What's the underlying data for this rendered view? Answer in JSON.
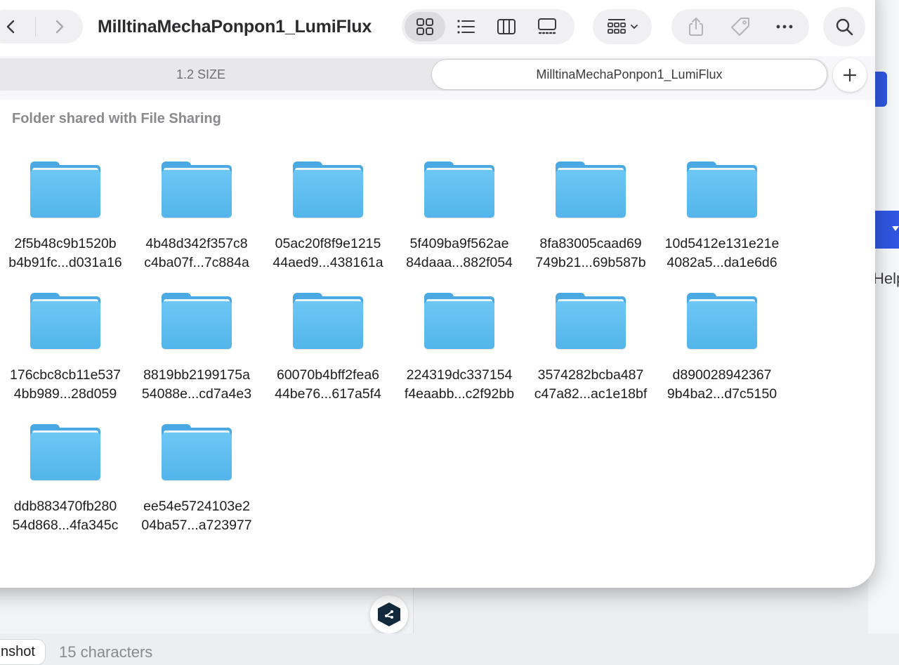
{
  "window": {
    "title": "MilltinaMechaPonpon1_LumiFlux"
  },
  "toolbar": {
    "nav": {
      "back_icon": "chevron-left-icon",
      "forward_icon": "chevron-right-icon"
    },
    "views": [
      {
        "icon": "icon-view-icon",
        "active": true
      },
      {
        "icon": "list-view-icon",
        "active": false
      },
      {
        "icon": "column-view-icon",
        "active": false
      },
      {
        "icon": "gallery-view-icon",
        "active": false
      }
    ],
    "group_icon": "group-by-icon",
    "actions": [
      "share-icon",
      "tag-icon",
      "more-icon"
    ],
    "search_icon": "search-icon"
  },
  "tabs": [
    {
      "label": "1.2 SIZE",
      "active": false
    },
    {
      "label": "MilltinaMechaPonpon1_LumiFlux",
      "active": true
    }
  ],
  "section": {
    "header": "Folder shared with File Sharing"
  },
  "folders": [
    {
      "line1": "2f5b48c9b1520b",
      "line2": "b4b91fc...d031a16"
    },
    {
      "line1": "4b48d342f357c8",
      "line2": "c4ba07f...7c884a"
    },
    {
      "line1": "05ac20f8f9e1215",
      "line2": "44aed9...438161a"
    },
    {
      "line1": "5f409ba9f562ae",
      "line2": "84daaa...882f054"
    },
    {
      "line1": "8fa83005caad69",
      "line2": "749b21...69b587b"
    },
    {
      "line1": "10d5412e131e21e",
      "line2": "4082a5...da1e6d6"
    },
    {
      "line1": "176cbc8cb11e537",
      "line2": "4bb989...28d059"
    },
    {
      "line1": "8819bb2199175a",
      "line2": "54088e...cd7a4e3"
    },
    {
      "line1": "60070b4bff2fea6",
      "line2": "44be76...617a5f4"
    },
    {
      "line1": "224319dc337154",
      "line2": "f4eaabb...c2f92bb"
    },
    {
      "line1": "3574282bcba487",
      "line2": "c47a82...ac1e18bf"
    },
    {
      "line1": "d890028942367",
      "line2": "9b4ba2...d7c5150"
    },
    {
      "line1": "ddb883470fb280",
      "line2": "54d868...4fa345c"
    },
    {
      "line1": "ee54e5724103e2",
      "line2": "04ba57...a723977"
    }
  ],
  "background_app": {
    "help_text": "Help",
    "tab_chip": "nshot",
    "char_count": "15 characters"
  },
  "colors": {
    "folder": "#56b8ec",
    "accent_blue": "#2f56e0",
    "window_bg": "#ffffff"
  }
}
